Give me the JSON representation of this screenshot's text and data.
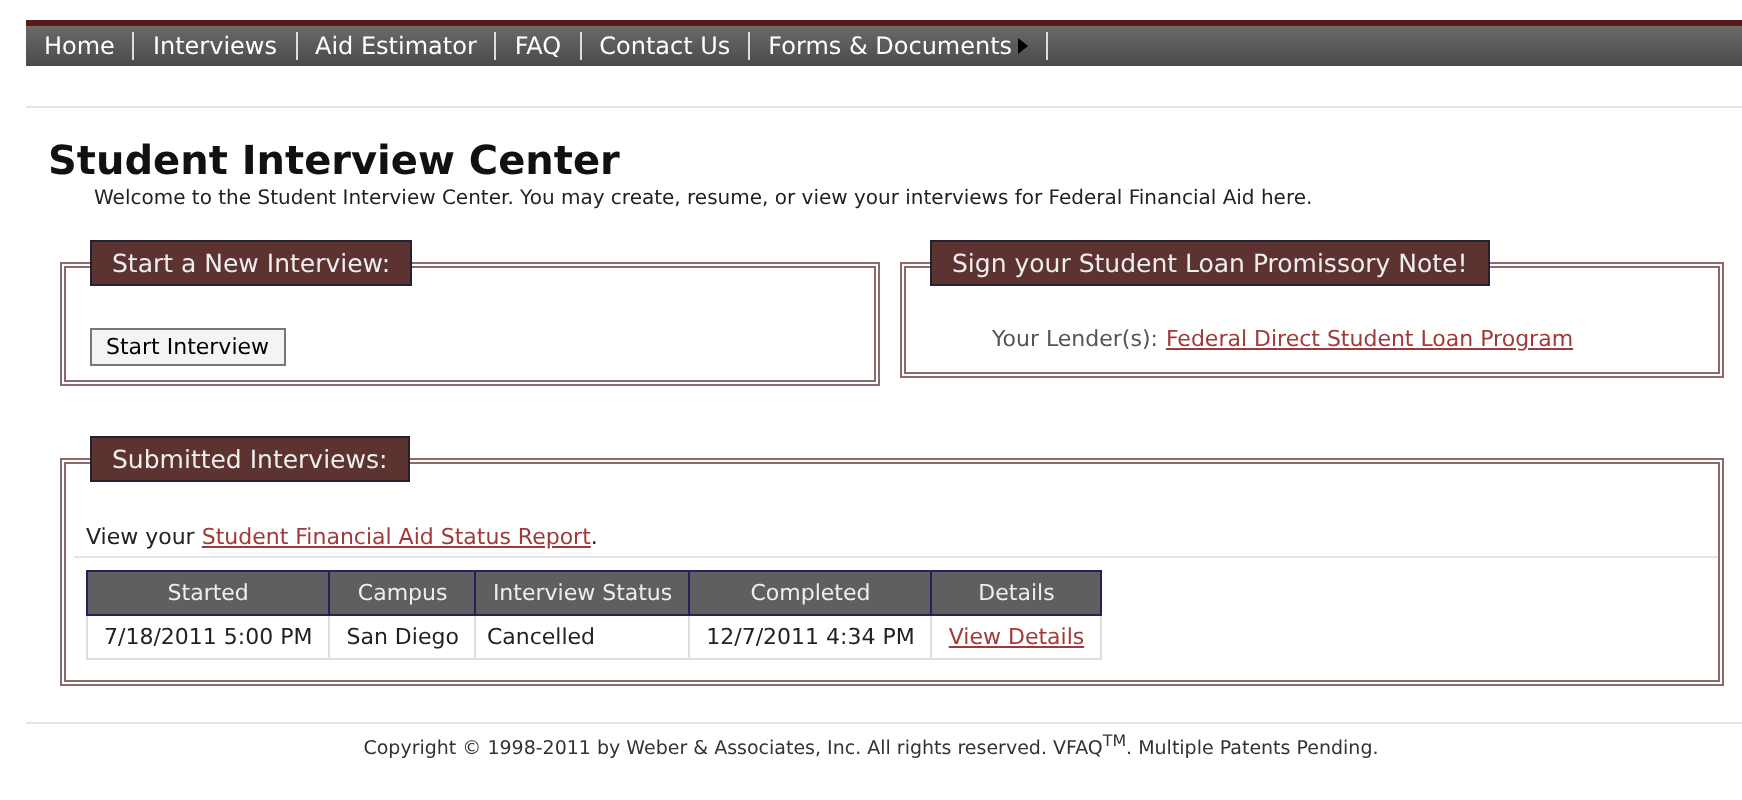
{
  "nav": [
    {
      "label": "Home",
      "has_submenu": false
    },
    {
      "label": "Interviews",
      "has_submenu": false
    },
    {
      "label": "Aid Estimator",
      "has_submenu": false
    },
    {
      "label": "FAQ",
      "has_submenu": false
    },
    {
      "label": "Contact Us",
      "has_submenu": false
    },
    {
      "label": "Forms & Documents",
      "has_submenu": true
    }
  ],
  "title": "Student Interview Center",
  "intro": "Welcome to the Student Interview Center. You may create, resume, or view your interviews for Federal Financial Aid here.",
  "new_interview": {
    "heading": "Start a New Interview:",
    "button": "Start Interview"
  },
  "promissory": {
    "heading": "Sign your Student Loan Promissory Note!",
    "label": "Your Lender(s):",
    "link": "Federal Direct Student Loan Program"
  },
  "submitted": {
    "heading": "Submitted Interviews:",
    "prefix": "View your",
    "link": "Student Financial Aid Status Report",
    "suffix": ".",
    "table": {
      "columns": [
        "Started",
        "Campus",
        "Interview Status",
        "Completed",
        "Details"
      ],
      "rows": [
        {
          "started": "7/18/2011 5:00 PM",
          "campus": "San Diego",
          "status": "Cancelled",
          "completed": "12/7/2011 4:34 PM",
          "details": "View Details"
        }
      ]
    }
  },
  "footer": "Copyright © 1998-2011 by Weber & Associates, Inc. All rights reserved. VFAQ$^{TM}$. Multiple Patents Pending."
}
